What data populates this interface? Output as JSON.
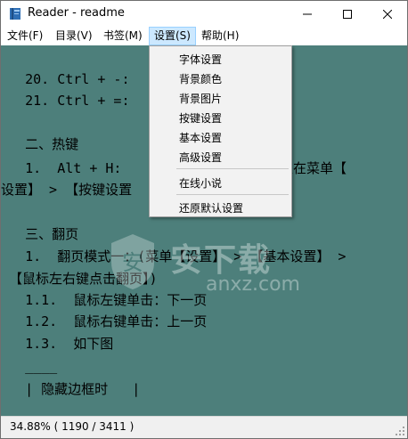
{
  "window": {
    "title": "Reader - readme",
    "controls": {
      "minimize_icon": "minimize-icon",
      "maximize_icon": "maximize-icon",
      "close_icon": "close-icon"
    }
  },
  "menubar": {
    "items": [
      {
        "label": "文件(F)"
      },
      {
        "label": "目录(V)"
      },
      {
        "label": "书签(M)"
      },
      {
        "label": "设置(S)",
        "active": true
      },
      {
        "label": "帮助(H)"
      }
    ]
  },
  "settings_menu": {
    "items": [
      {
        "label": "字体设置"
      },
      {
        "label": "背景颜色"
      },
      {
        "label": "背景图片"
      },
      {
        "label": "按键设置"
      },
      {
        "label": "基本设置"
      },
      {
        "label": "高级设置"
      },
      {
        "label": "在线小说"
      },
      {
        "label": "还原默认设置"
      }
    ]
  },
  "document": {
    "lines": [
      "   20. Ctrl + -: ",
      "   21. Ctrl + =: ",
      "",
      "   二、热键",
      "   1.  Alt + H:                 (可以在菜单【",
      "设置】 > 【按键设置",
      "",
      "   三、翻页",
      "   1.  翻页模式一：(菜单【设置】 > 【基本设置】 >",
      " 【鼠标左右键点击翻页】)",
      "   1.1.  鼠标左键单击：下一页",
      "   1.2.  鼠标右键单击：上一页",
      "   1.3.  如下图",
      "   ____",
      "   | 隐藏边框时   |"
    ],
    "background_color": "#4d7f7b"
  },
  "watermark": {
    "text": "安下载",
    "subtext": "anxz.com"
  },
  "status": {
    "text": "34.88%  ( 1190 / 3411 )"
  }
}
